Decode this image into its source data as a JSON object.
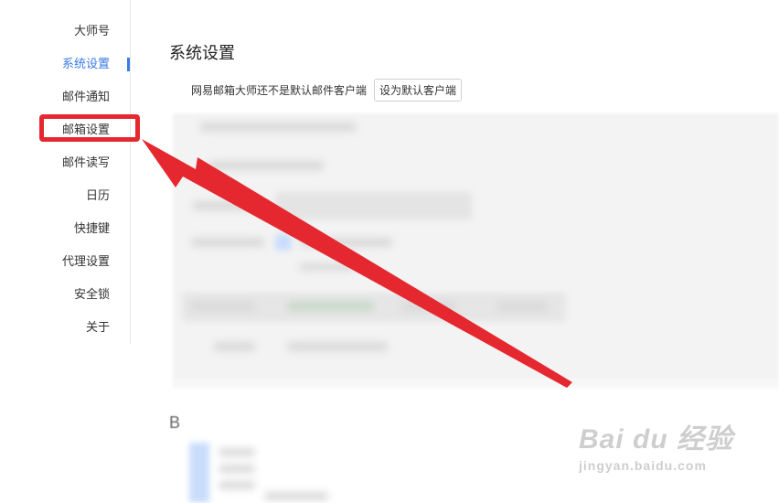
{
  "sidebar": {
    "items": [
      {
        "label": "大师号"
      },
      {
        "label": "系统设置"
      },
      {
        "label": "邮件通知"
      },
      {
        "label": "邮箱设置"
      },
      {
        "label": "邮件读写"
      },
      {
        "label": "日历"
      },
      {
        "label": "快捷键"
      },
      {
        "label": "代理设置"
      },
      {
        "label": "安全锁"
      },
      {
        "label": "关于"
      }
    ],
    "active_index": 1
  },
  "main": {
    "title": "系统设置",
    "default_client_text": "网易邮箱大师还不是默认邮件客户端",
    "set_default_button": "设为默认客户端",
    "section_fragment": "B"
  },
  "annotation": {
    "color": "#e5282f",
    "highlighted_item": "邮箱设置"
  },
  "watermark": {
    "logo": "Bai du 经验",
    "url": "jingyan.baidu.com"
  },
  "colors": {
    "accent": "#3a7be6",
    "annotation_red": "#e5282f"
  }
}
